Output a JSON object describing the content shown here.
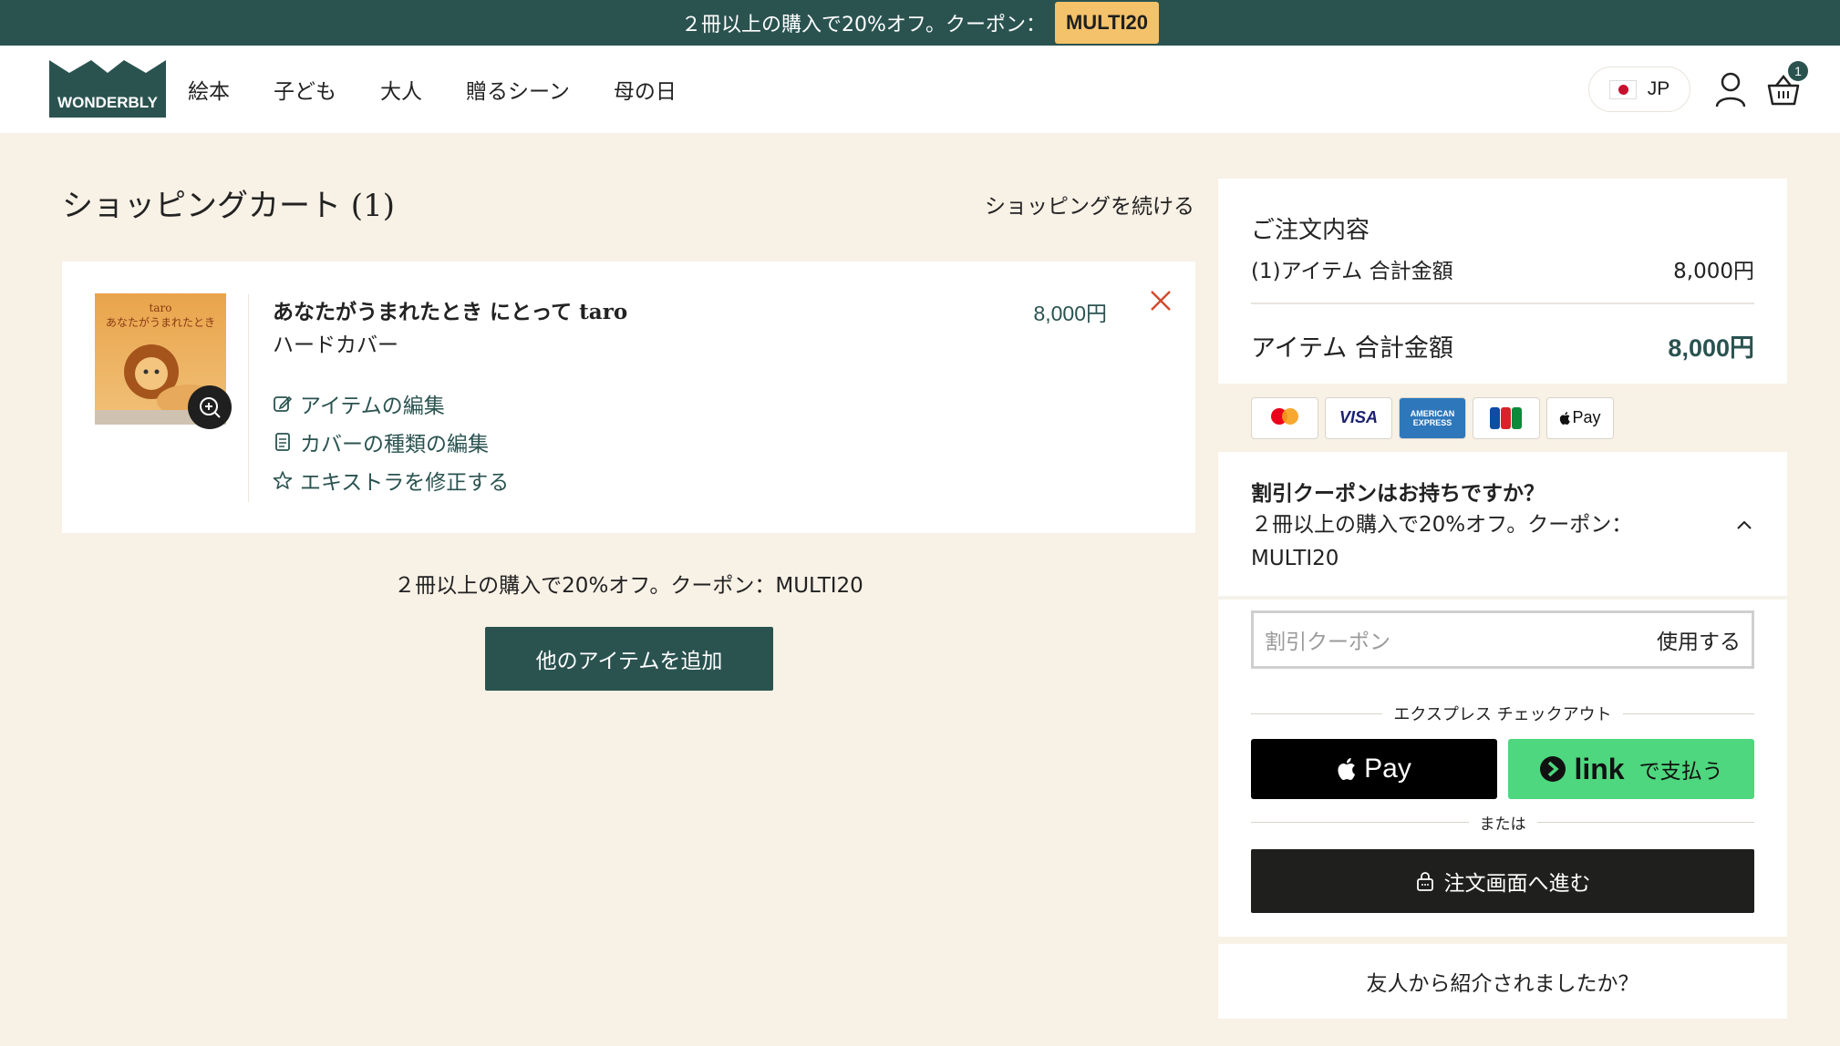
{
  "promo_banner": {
    "text": "２冊以上の購入で20%オフ。クーポン：",
    "code": "MULTI20"
  },
  "header": {
    "logo": "WONDERBLY",
    "nav": [
      "絵本",
      "子ども",
      "大人",
      "贈るシーン",
      "母の日"
    ],
    "locale": "JP",
    "cart_count": "1"
  },
  "cart": {
    "title": "ショッピングカート (1)",
    "continue_label": "ショッピングを続ける",
    "item": {
      "cover_title": "taro",
      "cover_subtitle": "あなたがうまれたとき",
      "name": "あなたがうまれたとき にとって taro",
      "variant": "ハードカバー",
      "price": "8,000円",
      "actions": [
        "アイテムの編集",
        "カバーの種類の編集",
        "エキストラを修正する"
      ]
    },
    "promo_line": "２冊以上の購入で20%オフ。クーポン：MULTI20",
    "add_more_label": "他のアイテムを追加"
  },
  "summary": {
    "heading": "ご注文内容",
    "subtotal_label": "(1)アイテム 合計金額",
    "subtotal_value": "8,000円",
    "total_label": "アイテム 合計金額",
    "total_value": "8,000円",
    "payment_icons": [
      "mastercard-icon",
      "visa-icon",
      "amex-icon",
      "jcb-icon",
      "apple-pay-icon"
    ],
    "coupon_question": "割引クーポンはお持ちですか？",
    "coupon_desc": "２冊以上の購入で20%オフ。クーポン：MULTI20",
    "coupon_placeholder": "割引クーポン",
    "coupon_apply": "使用する",
    "express_label": "エクスプレス チェックアウト",
    "apple_pay_label": "Pay",
    "link_label": "link",
    "link_pay_label": "で支払う",
    "or_label": "または",
    "checkout_label": "注文画面へ進む",
    "referral_label": "友人から紹介されましたか？"
  },
  "colors": {
    "brand": "#2a5350",
    "promo_code_bg": "#f3c26b",
    "page_bg": "#f8f1e6",
    "link_green": "#4ed77e",
    "remove_red": "#d24a2e"
  }
}
